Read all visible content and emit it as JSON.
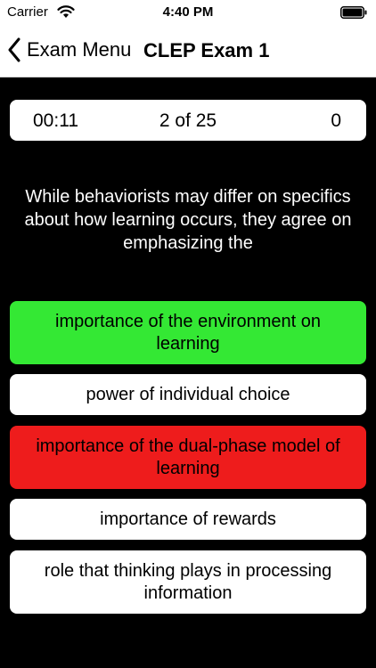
{
  "status_bar": {
    "carrier": "Carrier",
    "time": "4:40 PM"
  },
  "nav": {
    "back_label": "Exam Menu",
    "title": "CLEP Exam 1"
  },
  "score_card": {
    "timer": "00:11",
    "progress": "2 of 25",
    "score": "0"
  },
  "question": "While behaviorists may differ on specifics about how learning occurs, they agree on emphasizing the",
  "answers": [
    {
      "text": "importance of the environment on learning",
      "state": "correct"
    },
    {
      "text": "power of individual choice",
      "state": "neutral"
    },
    {
      "text": "importance of the dual-phase model of learning",
      "state": "wrong"
    },
    {
      "text": "importance of rewards",
      "state": "neutral"
    },
    {
      "text": "role that thinking plays in processing information",
      "state": "neutral"
    }
  ],
  "colors": {
    "correct": "#34e834",
    "wrong": "#ee1c1c",
    "neutral": "#ffffff",
    "background": "#000000"
  }
}
